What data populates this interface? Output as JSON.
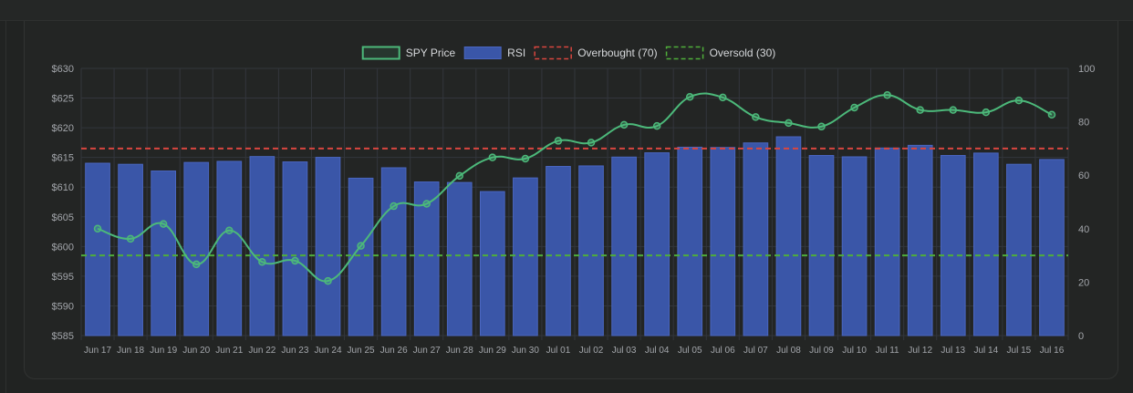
{
  "chart_data": {
    "type": "bar-line",
    "categories": [
      "Jun 17",
      "Jun 18",
      "Jun 19",
      "Jun 20",
      "Jun 21",
      "Jun 22",
      "Jun 23",
      "Jun 24",
      "Jun 25",
      "Jun 26",
      "Jun 27",
      "Jun 28",
      "Jun 29",
      "Jun 30",
      "Jul 01",
      "Jul 02",
      "Jul 03",
      "Jul 04",
      "Jul 05",
      "Jul 06",
      "Jul 07",
      "Jul 08",
      "Jul 09",
      "Jul 10",
      "Jul 11",
      "Jul 12",
      "Jul 13",
      "Jul 14",
      "Jul 15",
      "Jul 16"
    ],
    "series": [
      {
        "name": "SPY Price",
        "kind": "line",
        "axis": "left",
        "color": "#4cb97a",
        "values": [
          603.0,
          601.3,
          603.8,
          597.0,
          602.7,
          597.4,
          597.6,
          594.2,
          600.1,
          606.8,
          607.2,
          611.9,
          615.0,
          614.8,
          617.8,
          617.5,
          620.5,
          620.3,
          625.2,
          625.1,
          621.8,
          620.8,
          620.2,
          623.4,
          625.5,
          623.0,
          623.0,
          622.6,
          624.6,
          622.2
        ]
      },
      {
        "name": "RSI",
        "kind": "bar",
        "axis": "right",
        "color": "#3a56a8",
        "values": [
          64.5,
          64.1,
          61.6,
          64.8,
          65.2,
          67.0,
          65.0,
          66.7,
          58.9,
          62.8,
          57.5,
          57.3,
          53.9,
          59.0,
          63.3,
          63.5,
          66.8,
          68.4,
          70.5,
          70.4,
          72.1,
          74.4,
          67.4,
          66.9,
          70.2,
          71.2,
          67.4,
          68.3,
          64.1,
          65.9
        ]
      },
      {
        "name": "Overbought (70)",
        "kind": "threshold",
        "axis": "right",
        "value": 70,
        "color": "#d9463f"
      },
      {
        "name": "Oversold (30)",
        "kind": "threshold",
        "axis": "right",
        "value": 30,
        "color": "#4fae3a"
      }
    ],
    "y_left": {
      "ticks": [
        "$630",
        "$625",
        "$620",
        "$615",
        "$610",
        "$605",
        "$600",
        "$595",
        "$590",
        "$585"
      ],
      "ylim": [
        585,
        630
      ]
    },
    "y_right": {
      "ticks": [
        "100",
        "80",
        "60",
        "40",
        "20",
        "0"
      ],
      "ylim": [
        0,
        100
      ]
    },
    "grid": true,
    "legend": "top-center"
  }
}
